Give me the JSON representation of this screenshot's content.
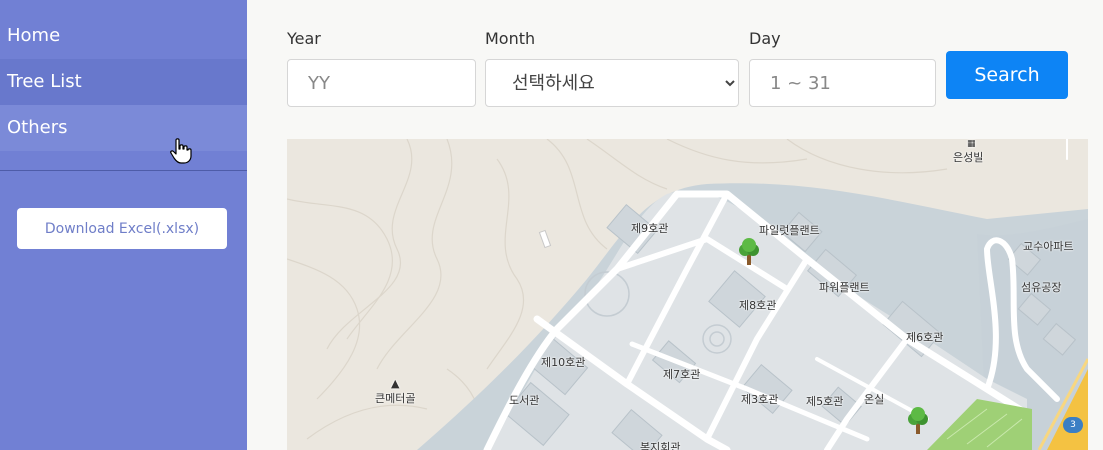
{
  "sidebar": {
    "items": [
      {
        "label": "Home"
      },
      {
        "label": "Tree List"
      },
      {
        "label": "Others"
      }
    ],
    "download_label": "Download Excel(.xlsx)"
  },
  "form": {
    "year": {
      "label": "Year",
      "placeholder": "YY"
    },
    "month": {
      "label": "Month",
      "selected": "선택하세요"
    },
    "day": {
      "label": "Day",
      "placeholder": "1 ~ 31"
    },
    "search_label": "Search"
  },
  "map": {
    "labels": {
      "eunseongbil": "은성빌",
      "b9": "제9호관",
      "pilot_plant": "파일럿플랜트",
      "prof_apt": "교수아파트",
      "power_plant": "파워플랜트",
      "fiber": "섬유공장",
      "b8": "제8호관",
      "b6": "제6호관",
      "b10": "제10호관",
      "b7": "제7호관",
      "keunmeteogol": "큰메터골",
      "library": "도서관",
      "b3": "제3호관",
      "b5": "제5호관",
      "greenhouse": "온실",
      "welfare": "복지회관",
      "road_badge": "3"
    },
    "tree_markers": 2
  },
  "colors": {
    "sidebar_bg": "#7180d4",
    "search_button": "#0d84f5",
    "map_water": "#c9d3d9",
    "map_campus": "#dfe3e6"
  },
  "icons": [
    "tree-marker-icon",
    "pointer-hand-icon",
    "peak-icon",
    "building-icon"
  ]
}
